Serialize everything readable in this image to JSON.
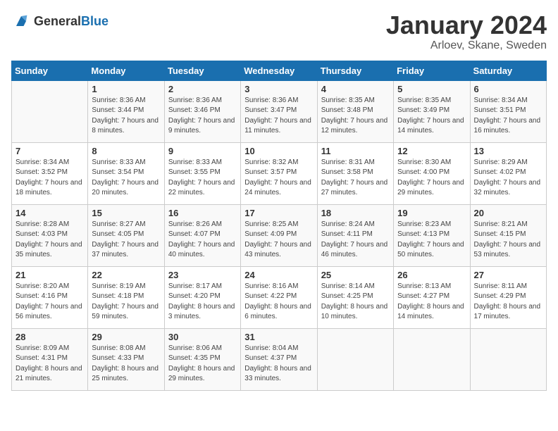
{
  "header": {
    "logo_general": "General",
    "logo_blue": "Blue",
    "title": "January 2024",
    "subtitle": "Arloev, Skane, Sweden"
  },
  "days_of_week": [
    "Sunday",
    "Monday",
    "Tuesday",
    "Wednesday",
    "Thursday",
    "Friday",
    "Saturday"
  ],
  "weeks": [
    [
      {
        "day": "",
        "sunrise": "",
        "sunset": "",
        "daylight": ""
      },
      {
        "day": "1",
        "sunrise": "Sunrise: 8:36 AM",
        "sunset": "Sunset: 3:44 PM",
        "daylight": "Daylight: 7 hours and 8 minutes."
      },
      {
        "day": "2",
        "sunrise": "Sunrise: 8:36 AM",
        "sunset": "Sunset: 3:46 PM",
        "daylight": "Daylight: 7 hours and 9 minutes."
      },
      {
        "day": "3",
        "sunrise": "Sunrise: 8:36 AM",
        "sunset": "Sunset: 3:47 PM",
        "daylight": "Daylight: 7 hours and 11 minutes."
      },
      {
        "day": "4",
        "sunrise": "Sunrise: 8:35 AM",
        "sunset": "Sunset: 3:48 PM",
        "daylight": "Daylight: 7 hours and 12 minutes."
      },
      {
        "day": "5",
        "sunrise": "Sunrise: 8:35 AM",
        "sunset": "Sunset: 3:49 PM",
        "daylight": "Daylight: 7 hours and 14 minutes."
      },
      {
        "day": "6",
        "sunrise": "Sunrise: 8:34 AM",
        "sunset": "Sunset: 3:51 PM",
        "daylight": "Daylight: 7 hours and 16 minutes."
      }
    ],
    [
      {
        "day": "7",
        "sunrise": "Sunrise: 8:34 AM",
        "sunset": "Sunset: 3:52 PM",
        "daylight": "Daylight: 7 hours and 18 minutes."
      },
      {
        "day": "8",
        "sunrise": "Sunrise: 8:33 AM",
        "sunset": "Sunset: 3:54 PM",
        "daylight": "Daylight: 7 hours and 20 minutes."
      },
      {
        "day": "9",
        "sunrise": "Sunrise: 8:33 AM",
        "sunset": "Sunset: 3:55 PM",
        "daylight": "Daylight: 7 hours and 22 minutes."
      },
      {
        "day": "10",
        "sunrise": "Sunrise: 8:32 AM",
        "sunset": "Sunset: 3:57 PM",
        "daylight": "Daylight: 7 hours and 24 minutes."
      },
      {
        "day": "11",
        "sunrise": "Sunrise: 8:31 AM",
        "sunset": "Sunset: 3:58 PM",
        "daylight": "Daylight: 7 hours and 27 minutes."
      },
      {
        "day": "12",
        "sunrise": "Sunrise: 8:30 AM",
        "sunset": "Sunset: 4:00 PM",
        "daylight": "Daylight: 7 hours and 29 minutes."
      },
      {
        "day": "13",
        "sunrise": "Sunrise: 8:29 AM",
        "sunset": "Sunset: 4:02 PM",
        "daylight": "Daylight: 7 hours and 32 minutes."
      }
    ],
    [
      {
        "day": "14",
        "sunrise": "Sunrise: 8:28 AM",
        "sunset": "Sunset: 4:03 PM",
        "daylight": "Daylight: 7 hours and 35 minutes."
      },
      {
        "day": "15",
        "sunrise": "Sunrise: 8:27 AM",
        "sunset": "Sunset: 4:05 PM",
        "daylight": "Daylight: 7 hours and 37 minutes."
      },
      {
        "day": "16",
        "sunrise": "Sunrise: 8:26 AM",
        "sunset": "Sunset: 4:07 PM",
        "daylight": "Daylight: 7 hours and 40 minutes."
      },
      {
        "day": "17",
        "sunrise": "Sunrise: 8:25 AM",
        "sunset": "Sunset: 4:09 PM",
        "daylight": "Daylight: 7 hours and 43 minutes."
      },
      {
        "day": "18",
        "sunrise": "Sunrise: 8:24 AM",
        "sunset": "Sunset: 4:11 PM",
        "daylight": "Daylight: 7 hours and 46 minutes."
      },
      {
        "day": "19",
        "sunrise": "Sunrise: 8:23 AM",
        "sunset": "Sunset: 4:13 PM",
        "daylight": "Daylight: 7 hours and 50 minutes."
      },
      {
        "day": "20",
        "sunrise": "Sunrise: 8:21 AM",
        "sunset": "Sunset: 4:15 PM",
        "daylight": "Daylight: 7 hours and 53 minutes."
      }
    ],
    [
      {
        "day": "21",
        "sunrise": "Sunrise: 8:20 AM",
        "sunset": "Sunset: 4:16 PM",
        "daylight": "Daylight: 7 hours and 56 minutes."
      },
      {
        "day": "22",
        "sunrise": "Sunrise: 8:19 AM",
        "sunset": "Sunset: 4:18 PM",
        "daylight": "Daylight: 7 hours and 59 minutes."
      },
      {
        "day": "23",
        "sunrise": "Sunrise: 8:17 AM",
        "sunset": "Sunset: 4:20 PM",
        "daylight": "Daylight: 8 hours and 3 minutes."
      },
      {
        "day": "24",
        "sunrise": "Sunrise: 8:16 AM",
        "sunset": "Sunset: 4:22 PM",
        "daylight": "Daylight: 8 hours and 6 minutes."
      },
      {
        "day": "25",
        "sunrise": "Sunrise: 8:14 AM",
        "sunset": "Sunset: 4:25 PM",
        "daylight": "Daylight: 8 hours and 10 minutes."
      },
      {
        "day": "26",
        "sunrise": "Sunrise: 8:13 AM",
        "sunset": "Sunset: 4:27 PM",
        "daylight": "Daylight: 8 hours and 14 minutes."
      },
      {
        "day": "27",
        "sunrise": "Sunrise: 8:11 AM",
        "sunset": "Sunset: 4:29 PM",
        "daylight": "Daylight: 8 hours and 17 minutes."
      }
    ],
    [
      {
        "day": "28",
        "sunrise": "Sunrise: 8:09 AM",
        "sunset": "Sunset: 4:31 PM",
        "daylight": "Daylight: 8 hours and 21 minutes."
      },
      {
        "day": "29",
        "sunrise": "Sunrise: 8:08 AM",
        "sunset": "Sunset: 4:33 PM",
        "daylight": "Daylight: 8 hours and 25 minutes."
      },
      {
        "day": "30",
        "sunrise": "Sunrise: 8:06 AM",
        "sunset": "Sunset: 4:35 PM",
        "daylight": "Daylight: 8 hours and 29 minutes."
      },
      {
        "day": "31",
        "sunrise": "Sunrise: 8:04 AM",
        "sunset": "Sunset: 4:37 PM",
        "daylight": "Daylight: 8 hours and 33 minutes."
      },
      {
        "day": "",
        "sunrise": "",
        "sunset": "",
        "daylight": ""
      },
      {
        "day": "",
        "sunrise": "",
        "sunset": "",
        "daylight": ""
      },
      {
        "day": "",
        "sunrise": "",
        "sunset": "",
        "daylight": ""
      }
    ]
  ]
}
